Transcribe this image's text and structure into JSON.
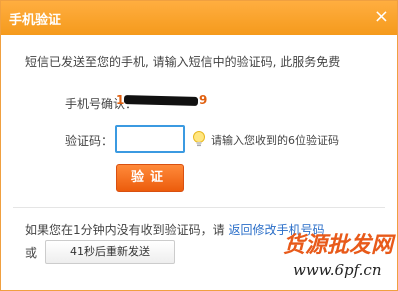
{
  "dialog": {
    "title": "手机验证",
    "close_icon": "×"
  },
  "info_text": "短信已发送至您的手机, 请输入短信中的验证码, 此服务免费",
  "phone": {
    "label": "手机号确认：",
    "first_digit": "1",
    "last_digit": "9"
  },
  "code": {
    "label": "验证码：",
    "value": "",
    "placeholder": "",
    "hint": "请输入您收到的6位验证码"
  },
  "verify_button": "验证",
  "notice": {
    "text": "如果您在1分钟内没有收到验证码，请 ",
    "link": "返回修改手机号码"
  },
  "or_label": "或",
  "resend_button": "41秒后重新发送",
  "watermark": {
    "text_cn": "货源批发网",
    "url": "www.6pf.cn"
  },
  "colors": {
    "titlebar": "#f59a1c",
    "button": "#ec5c0c",
    "link": "#2a6ec8",
    "input_border": "#3b9ae1"
  },
  "icons": {
    "close": "close-icon",
    "hint": "lightbulb-icon"
  }
}
